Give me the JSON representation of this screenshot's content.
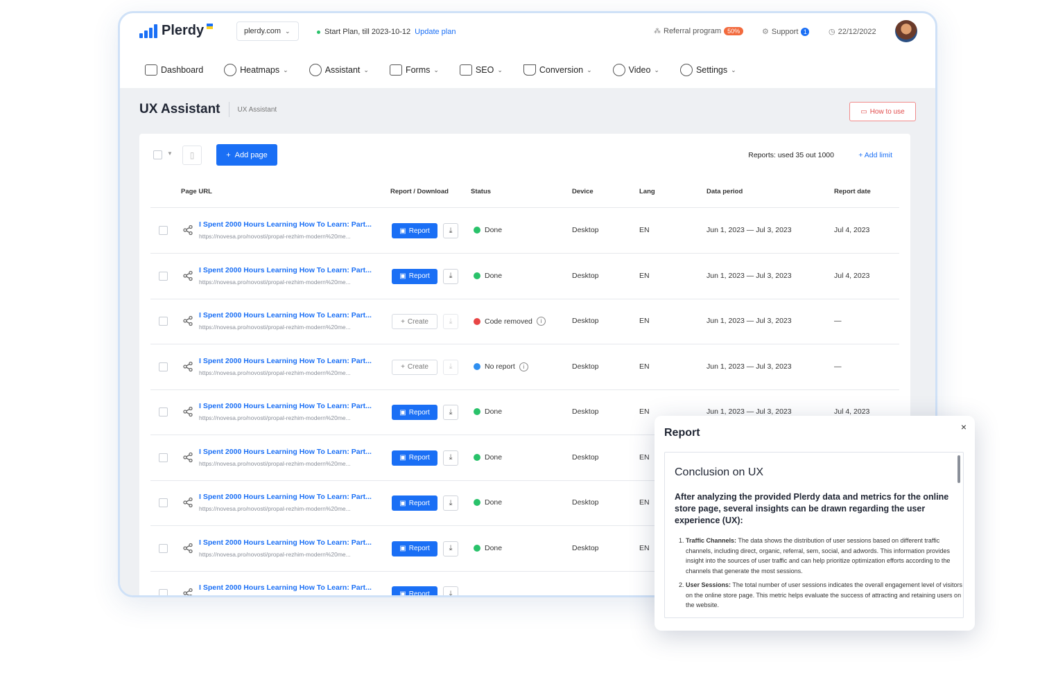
{
  "header": {
    "logo_text": "Plerdy",
    "domain": "plerdy.com",
    "plan": "Start Plan, till 2023-10-12",
    "update_plan": "Update plan",
    "referral": "Referral program",
    "referral_badge": "50%",
    "support": "Support",
    "support_badge": "1",
    "date": "22/12/2022"
  },
  "nav": [
    {
      "label": "Dashboard",
      "icon": "monitor-icon"
    },
    {
      "label": "Heatmaps",
      "icon": "globe-icon"
    },
    {
      "label": "Assistant",
      "icon": "ai-icon"
    },
    {
      "label": "Forms",
      "icon": "form-icon"
    },
    {
      "label": "SEO",
      "icon": "bar-chart-icon"
    },
    {
      "label": "Conversion",
      "icon": "funnel-icon"
    },
    {
      "label": "Video",
      "icon": "play-icon"
    },
    {
      "label": "Settings",
      "icon": "gear-icon"
    }
  ],
  "page": {
    "title": "UX Assistant",
    "breadcrumb": "UX Assistant",
    "how_to_use": "How to use"
  },
  "toolbar": {
    "add_page": "Add page",
    "reports_used": "Reports: used 35 out 1000",
    "add_limit": "Add limit"
  },
  "table": {
    "headers": [
      "Page URL",
      "Report / Download",
      "Status",
      "Device",
      "Lang",
      "Data period",
      "Report date"
    ],
    "rows": [
      {
        "title": "I Spent 2000 Hours Learning How To Learn: Part...",
        "url": "https://novesa.pro/novosti/propal-rezhim-modern%20me...",
        "action": "Report",
        "status": "Done",
        "status_color": "#29c26a",
        "device": "Desktop",
        "lang": "EN",
        "period": "Jun 1, 2023 — Jul 3, 2023",
        "date": "Jul 4, 2023"
      },
      {
        "title": "I Spent 2000 Hours Learning How To Learn: Part...",
        "url": "https://novesa.pro/novosti/propal-rezhim-modern%20me...",
        "action": "Report",
        "status": "Done",
        "status_color": "#29c26a",
        "device": "Desktop",
        "lang": "EN",
        "period": "Jun 1, 2023 — Jul 3, 2023",
        "date": "Jul 4, 2023"
      },
      {
        "title": "I Spent 2000 Hours Learning How To Learn: Part...",
        "url": "https://novesa.pro/novosti/propal-rezhim-modern%20me...",
        "action": "Create",
        "status": "Code removed",
        "status_color": "#e84545",
        "device": "Desktop",
        "lang": "EN",
        "period": "Jun 1, 2023 — Jul 3, 2023",
        "date": "—"
      },
      {
        "title": "I Spent 2000 Hours Learning How To Learn: Part...",
        "url": "https://novesa.pro/novosti/propal-rezhim-modern%20me...",
        "action": "Create",
        "status": "No report",
        "status_color": "#2f8ff0",
        "device": "Desktop",
        "lang": "EN",
        "period": "Jun 1, 2023 — Jul 3, 2023",
        "date": "—"
      },
      {
        "title": "I Spent 2000 Hours Learning How To Learn: Part...",
        "url": "https://novesa.pro/novosti/propal-rezhim-modern%20me...",
        "action": "Report",
        "status": "Done",
        "status_color": "#29c26a",
        "device": "Desktop",
        "lang": "EN",
        "period": "Jun 1, 2023 — Jul 3, 2023",
        "date": "Jul 4, 2023"
      },
      {
        "title": "I Spent 2000 Hours Learning How To Learn: Part...",
        "url": "https://novesa.pro/novosti/propal-rezhim-modern%20me...",
        "action": "Report",
        "status": "Done",
        "status_color": "#29c26a",
        "device": "Desktop",
        "lang": "EN",
        "period": "",
        "date": ""
      },
      {
        "title": "I Spent 2000 Hours Learning How To Learn: Part...",
        "url": "https://novesa.pro/novosti/propal-rezhim-modern%20me...",
        "action": "Report",
        "status": "Done",
        "status_color": "#29c26a",
        "device": "Desktop",
        "lang": "EN",
        "period": "",
        "date": ""
      },
      {
        "title": "I Spent 2000 Hours Learning How To Learn: Part...",
        "url": "https://novesa.pro/novosti/propal-rezhim-modern%20me...",
        "action": "Report",
        "status": "Done",
        "status_color": "#29c26a",
        "device": "Desktop",
        "lang": "EN",
        "period": "",
        "date": ""
      },
      {
        "title": "I Spent 2000 Hours Learning How To Learn: Part...",
        "url": "",
        "action": "Report",
        "status": "",
        "status_color": "#29c26a",
        "device": "",
        "lang": "",
        "period": "",
        "date": ""
      }
    ]
  },
  "popup": {
    "title": "Report",
    "heading": "Conclusion on UX",
    "intro": "After analyzing the provided Plerdy data and metrics for the online store page, several insights can be drawn regarding the user experience (UX):",
    "items": [
      {
        "label": "Traffic Channels:",
        "text": "The data shows the distribution of user sessions based on different traffic channels, including direct, organic, referral, sem, social, and adwords. This information provides insight into the sources of user traffic and can help prioritize optimization efforts according to the channels that generate the most sessions."
      },
      {
        "label": "User Sessions:",
        "text": "The total number of user sessions indicates the overall engagement level of visitors on the online store page. This metric helps evaluate the success of attracting and retaining users on the website."
      }
    ]
  },
  "colors": {
    "accent": "#1a6ff5",
    "done": "#29c26a",
    "error": "#e84545",
    "info": "#2f8ff0"
  }
}
